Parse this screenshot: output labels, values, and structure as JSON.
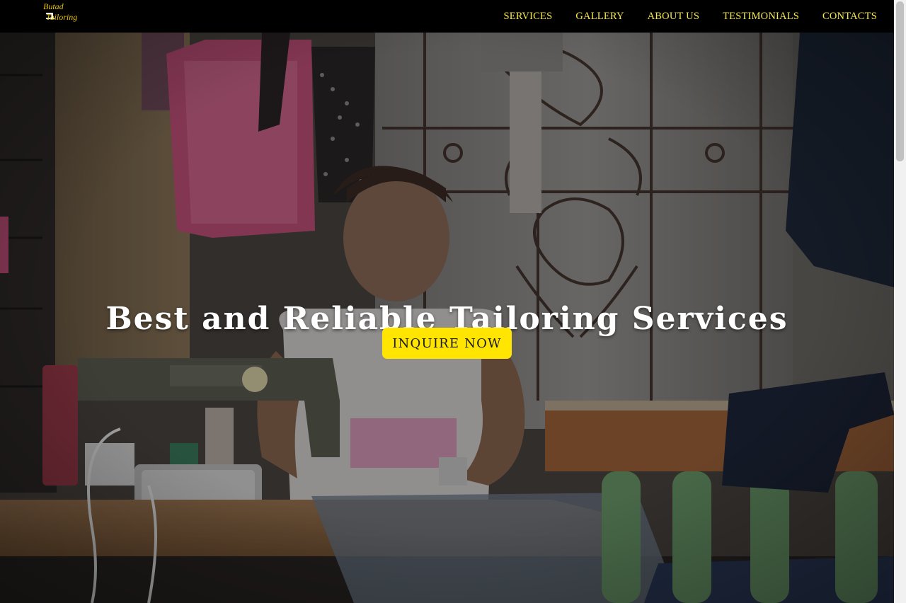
{
  "brand": {
    "name_line1": "Butad",
    "name_line2": "Tailoring",
    "logo_color": "#e8c400"
  },
  "nav": {
    "items": [
      {
        "label": "SERVICES"
      },
      {
        "label": "GALLERY"
      },
      {
        "label": "ABOUT US"
      },
      {
        "label": "TESTIMONIALS"
      },
      {
        "label": "CONTACTS"
      }
    ],
    "link_color": "#f6e94b"
  },
  "hero": {
    "title": "Best and Reliable Tailoring Services",
    "cta_label": "INQUIRE NOW",
    "cta_color": "#ffe500",
    "background_icon": "tailor-at-sewing-machine-photo"
  }
}
